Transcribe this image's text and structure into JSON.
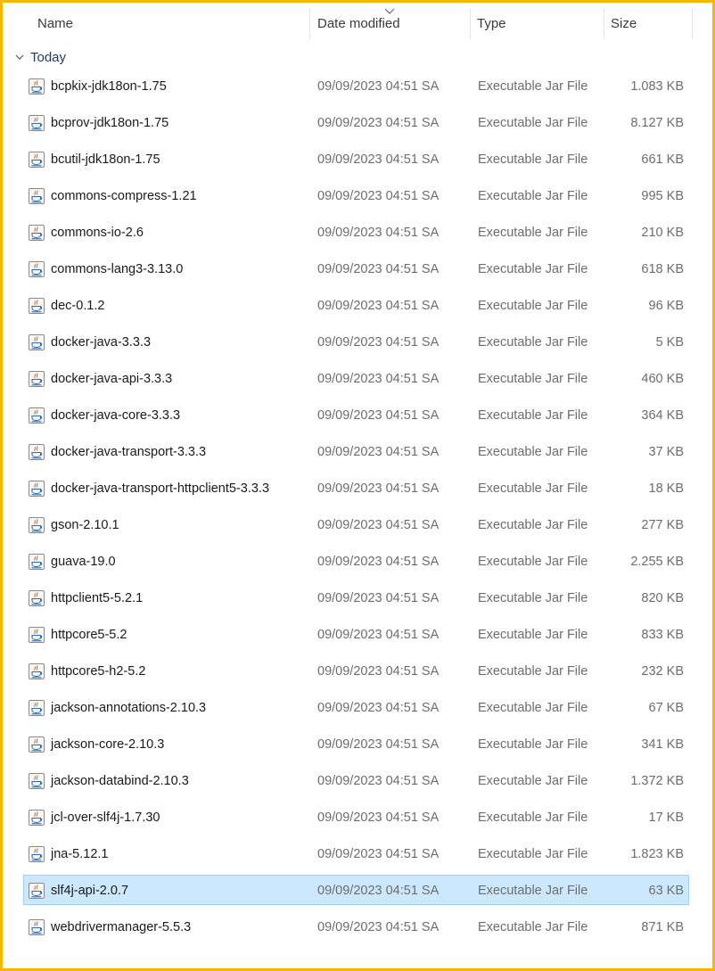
{
  "columns": {
    "name": "Name",
    "date_modified": "Date modified",
    "type": "Type",
    "size": "Size"
  },
  "group": {
    "label": "Today"
  },
  "icons": {
    "file": "jar-file-icon",
    "group_toggle": "chevron-down-icon",
    "sort": "sort-arrow-icon"
  },
  "selected_index": 22,
  "files": [
    {
      "name": "bcpkix-jdk18on-1.75",
      "date": "09/09/2023 04:51 SA",
      "type": "Executable Jar File",
      "size": "1.083 KB"
    },
    {
      "name": "bcprov-jdk18on-1.75",
      "date": "09/09/2023 04:51 SA",
      "type": "Executable Jar File",
      "size": "8.127 KB"
    },
    {
      "name": "bcutil-jdk18on-1.75",
      "date": "09/09/2023 04:51 SA",
      "type": "Executable Jar File",
      "size": "661 KB"
    },
    {
      "name": "commons-compress-1.21",
      "date": "09/09/2023 04:51 SA",
      "type": "Executable Jar File",
      "size": "995 KB"
    },
    {
      "name": "commons-io-2.6",
      "date": "09/09/2023 04:51 SA",
      "type": "Executable Jar File",
      "size": "210 KB"
    },
    {
      "name": "commons-lang3-3.13.0",
      "date": "09/09/2023 04:51 SA",
      "type": "Executable Jar File",
      "size": "618 KB"
    },
    {
      "name": "dec-0.1.2",
      "date": "09/09/2023 04:51 SA",
      "type": "Executable Jar File",
      "size": "96 KB"
    },
    {
      "name": "docker-java-3.3.3",
      "date": "09/09/2023 04:51 SA",
      "type": "Executable Jar File",
      "size": "5 KB"
    },
    {
      "name": "docker-java-api-3.3.3",
      "date": "09/09/2023 04:51 SA",
      "type": "Executable Jar File",
      "size": "460 KB"
    },
    {
      "name": "docker-java-core-3.3.3",
      "date": "09/09/2023 04:51 SA",
      "type": "Executable Jar File",
      "size": "364 KB"
    },
    {
      "name": "docker-java-transport-3.3.3",
      "date": "09/09/2023 04:51 SA",
      "type": "Executable Jar File",
      "size": "37 KB"
    },
    {
      "name": "docker-java-transport-httpclient5-3.3.3",
      "date": "09/09/2023 04:51 SA",
      "type": "Executable Jar File",
      "size": "18 KB"
    },
    {
      "name": "gson-2.10.1",
      "date": "09/09/2023 04:51 SA",
      "type": "Executable Jar File",
      "size": "277 KB"
    },
    {
      "name": "guava-19.0",
      "date": "09/09/2023 04:51 SA",
      "type": "Executable Jar File",
      "size": "2.255 KB"
    },
    {
      "name": "httpclient5-5.2.1",
      "date": "09/09/2023 04:51 SA",
      "type": "Executable Jar File",
      "size": "820 KB"
    },
    {
      "name": "httpcore5-5.2",
      "date": "09/09/2023 04:51 SA",
      "type": "Executable Jar File",
      "size": "833 KB"
    },
    {
      "name": "httpcore5-h2-5.2",
      "date": "09/09/2023 04:51 SA",
      "type": "Executable Jar File",
      "size": "232 KB"
    },
    {
      "name": "jackson-annotations-2.10.3",
      "date": "09/09/2023 04:51 SA",
      "type": "Executable Jar File",
      "size": "67 KB"
    },
    {
      "name": "jackson-core-2.10.3",
      "date": "09/09/2023 04:51 SA",
      "type": "Executable Jar File",
      "size": "341 KB"
    },
    {
      "name": "jackson-databind-2.10.3",
      "date": "09/09/2023 04:51 SA",
      "type": "Executable Jar File",
      "size": "1.372 KB"
    },
    {
      "name": "jcl-over-slf4j-1.7.30",
      "date": "09/09/2023 04:51 SA",
      "type": "Executable Jar File",
      "size": "17 KB"
    },
    {
      "name": "jna-5.12.1",
      "date": "09/09/2023 04:51 SA",
      "type": "Executable Jar File",
      "size": "1.823 KB"
    },
    {
      "name": "slf4j-api-2.0.7",
      "date": "09/09/2023 04:51 SA",
      "type": "Executable Jar File",
      "size": "63 KB"
    },
    {
      "name": "webdrivermanager-5.5.3",
      "date": "09/09/2023 04:51 SA",
      "type": "Executable Jar File",
      "size": "871 KB"
    }
  ]
}
